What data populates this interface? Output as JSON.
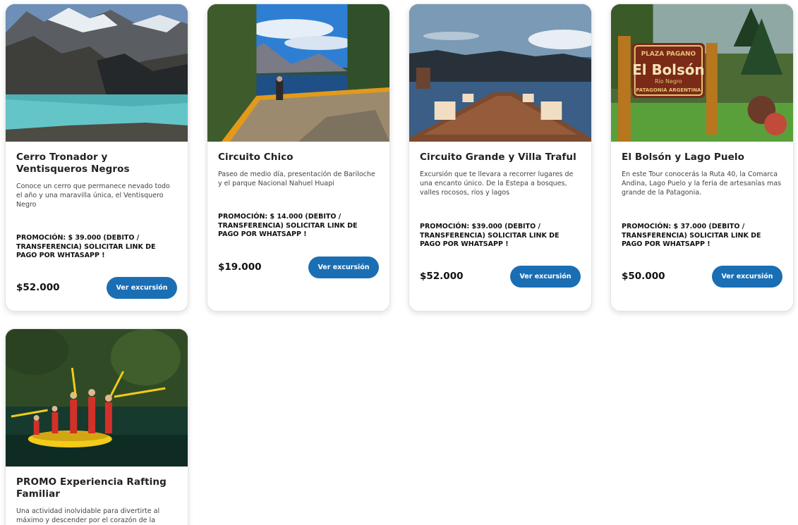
{
  "cards": [
    {
      "title": "Cerro Tronador y Ventisqueros Negros",
      "description": "Conoce un cerro que permanece nevado todo el año y una maravilla única, el Ventisquero Negro",
      "promo": "PROMOCIÓN: $ 39.000 (DEBITO / TRANSFERENCIA) SOLICITAR LINK DE PAGO POR WHTASAPP !",
      "price": "$52.000",
      "button": "Ver excursión"
    },
    {
      "title": "Circuito Chico",
      "description": "Paseo de medio día, presentación de Bariloche y el parque Nacional Nahuel Huapi",
      "promo": "PROMOCIÓN: $ 14.000 (DEBITO / TRANSFERENCIA) SOLICITAR LINK DE PAGO POR WHATSAPP !",
      "price": "$19.000",
      "button": "Ver excursión"
    },
    {
      "title": "Circuito Grande y Villa Traful",
      "description": "Excursión que te llevara a recorrer lugares de una encanto único. De la Estepa a bosques, valles rocosos, ríos y lagos",
      "promo": "PROMOCIÓN: $39.000  (DEBITO / TRANSFERENCIA) SOLICITAR LINK DE PAGO POR WHATSAPP !",
      "price": "$52.000",
      "button": "Ver excursión"
    },
    {
      "title": "El Bolsón y Lago Puelo",
      "description": "En este Tour conocerás la Ruta 40, la Comarca Andina, Lago Puelo y la feria de artesanías mas grande de la Patagonia.",
      "promo": "PROMOCIÓN: $ 37.000 (DEBITO / TRANSFERENCIA) SOLICITAR LINK DE PAGO POR WHATSAPP !",
      "price": "$50.000",
      "button": "Ver excursión",
      "sign": {
        "line1": "PLAZA PAGANO",
        "line2": "El Bolsón",
        "line3": "Río Negro",
        "line4": "PATAGONIA ARGENTINA"
      }
    },
    {
      "title": "PROMO Experiencia Rafting Familiar",
      "description": "Una actividad inolvidable para divertirte al máximo y descender por el corazón de la"
    }
  ],
  "colors": {
    "button": "#1a6eb4"
  }
}
